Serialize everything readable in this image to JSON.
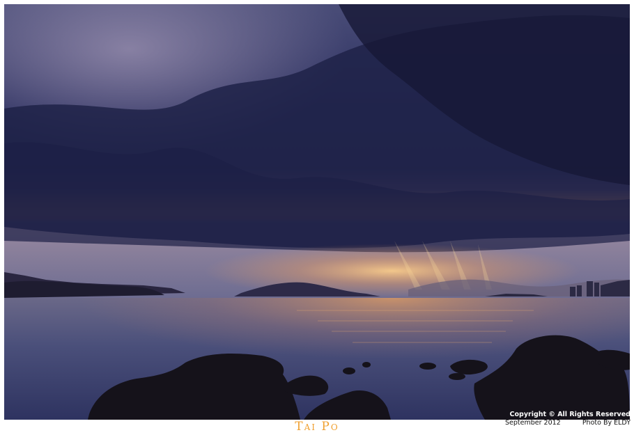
{
  "photo": {
    "title": "Tai Po",
    "copyright": "Copyright © All Rights Reserved",
    "date": "September 2012",
    "credit": "Photo By ELDY"
  },
  "colors": {
    "title": "#f0a030",
    "sky_top": "#3a3f66",
    "glow": "#f5a850",
    "water": "#3e4570"
  }
}
